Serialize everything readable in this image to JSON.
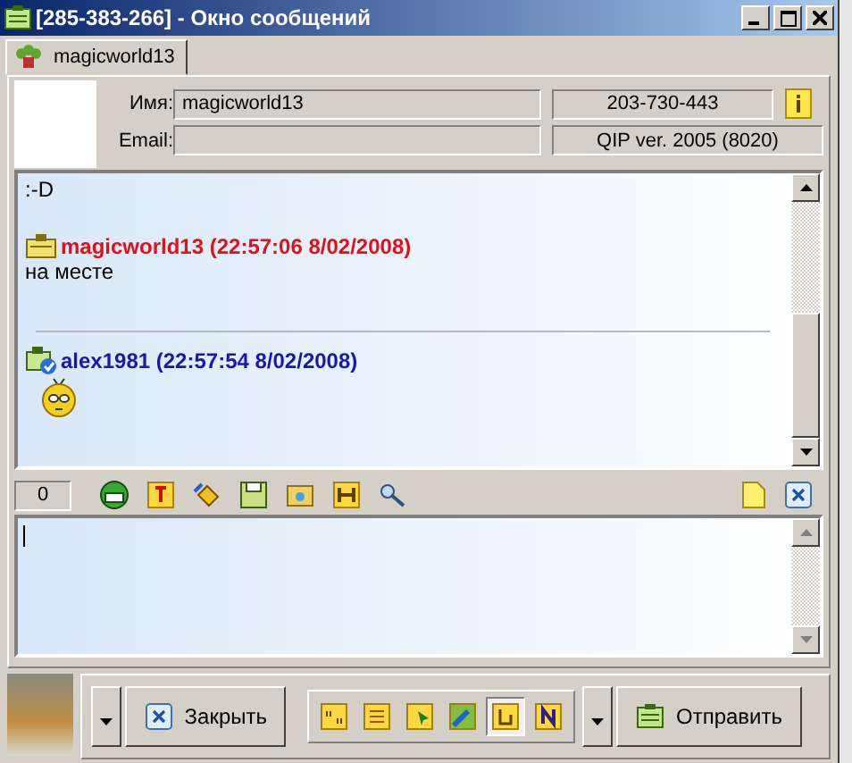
{
  "window": {
    "title": "[285-383-266] - Окно сообщений"
  },
  "tabs": [
    {
      "label": "magicworld13",
      "selected": true
    }
  ],
  "contact": {
    "name_label": "Имя:",
    "name": "magicworld13",
    "uin": "203-730-443",
    "email_label": "Email:",
    "client": "QIP ver. 2005 (8020)"
  },
  "messages": [
    {
      "kind": "text",
      "color": "#000000",
      "text": ":-D"
    },
    {
      "kind": "text",
      "header": "magicworld13 (22:57:06 8/02/2008)",
      "color": "#e0101c",
      "text": "на месте"
    },
    {
      "kind": "smiley",
      "header": "alex1981 (22:57:54 8/02/2008)",
      "color": "#1818b0"
    }
  ],
  "toolbar": {
    "counter": "0"
  },
  "bottom_tools": [
    {
      "pressed": false
    },
    {
      "pressed": false
    },
    {
      "pressed": false
    },
    {
      "pressed": false
    },
    {
      "pressed": true
    },
    {
      "pressed": false
    }
  ],
  "buttons": {
    "close": "Закрыть",
    "send": "Отправить"
  }
}
